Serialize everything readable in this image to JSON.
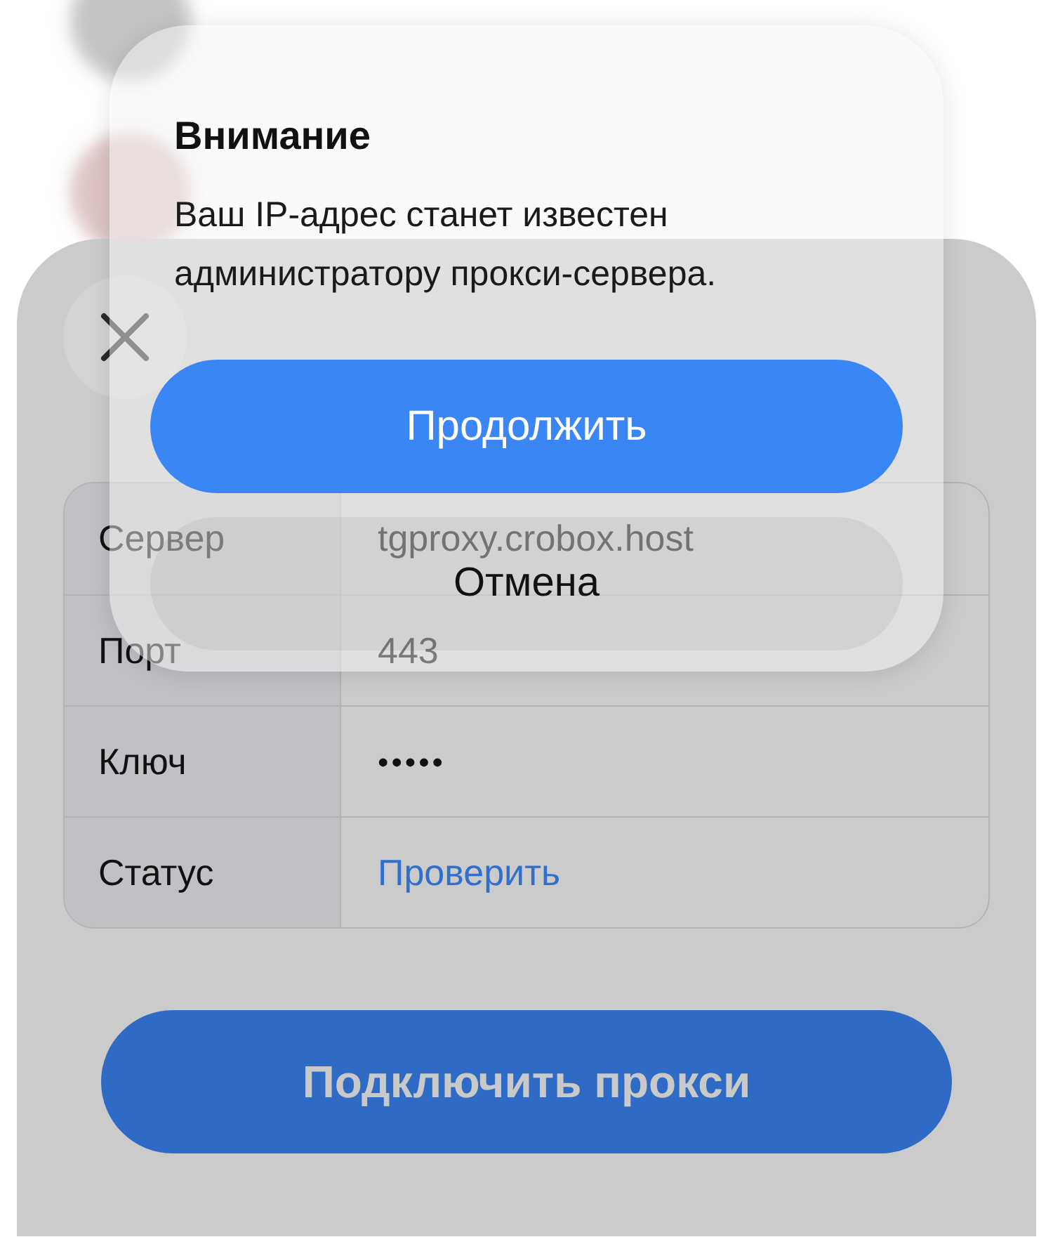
{
  "dialog": {
    "title": "Внимание",
    "message": "Ваш IP-адрес станет известен администратору прокси-сервера.",
    "buttons": [
      {
        "label": "Продолжить",
        "kind": "primary"
      },
      {
        "label": "Отмена",
        "kind": "cancel"
      }
    ]
  },
  "fields": [
    {
      "label": "Сервер",
      "value": "tgproxy.crobox.host",
      "kind": "text"
    },
    {
      "label": "Порт",
      "value": "443",
      "kind": "text"
    },
    {
      "label": "Ключ",
      "value": "•••••",
      "kind": "secret"
    },
    {
      "label": "Статус",
      "value": "Проверить",
      "kind": "link"
    }
  ],
  "connect_button": {
    "label": "Подключить прокси"
  }
}
